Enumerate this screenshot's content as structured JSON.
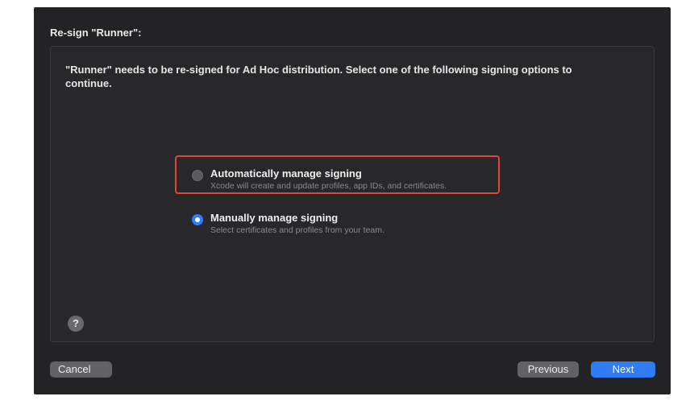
{
  "dialog": {
    "title": "Re-sign \"Runner\":",
    "intro": "\"Runner\" needs to be re-signed for Ad Hoc distribution. Select one of the following signing options to continue."
  },
  "options": [
    {
      "label": "Automatically manage signing",
      "description": "Xcode will create and update profiles, app IDs, and certificates.",
      "selected": false
    },
    {
      "label": "Manually manage signing",
      "description": "Select certificates and profiles from your team.",
      "selected": true
    }
  ],
  "help": {
    "symbol": "?",
    "icon": "question-mark-icon"
  },
  "buttons": {
    "cancel": "Cancel",
    "previous": "Previous",
    "next": "Next"
  },
  "colors": {
    "accent": "#2f7cf6",
    "highlight": "#e0453a",
    "background": "#232325"
  }
}
